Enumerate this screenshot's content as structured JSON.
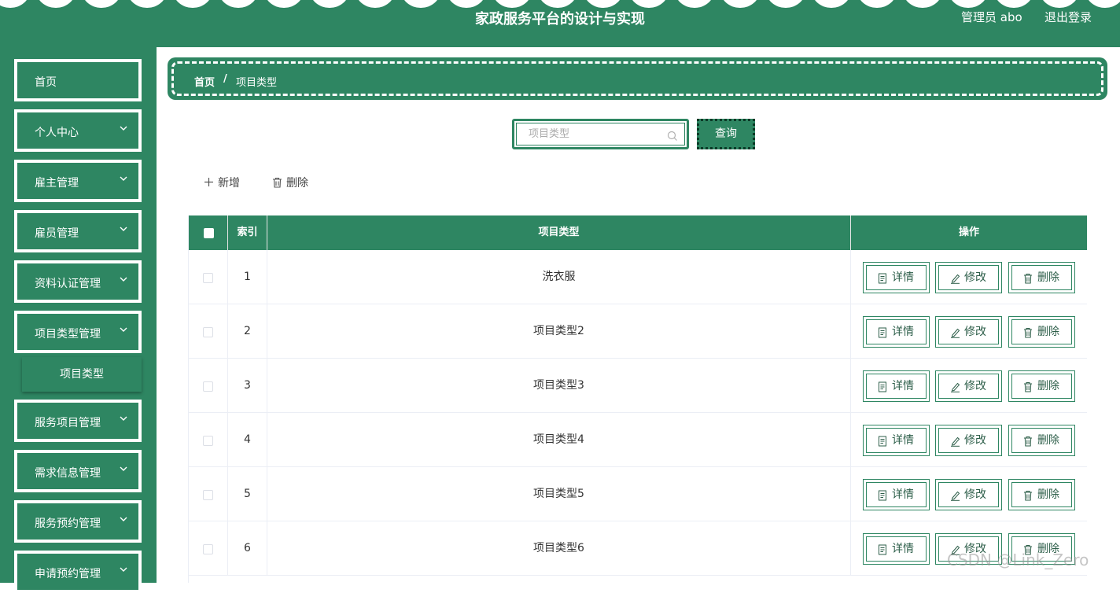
{
  "header": {
    "title": "家政服务平台的设计与实现",
    "user": "管理员 abo",
    "logout": "退出登录"
  },
  "sidebar": {
    "items": [
      {
        "label": "首页",
        "has_children": false
      },
      {
        "label": "个人中心",
        "has_children": true
      },
      {
        "label": "雇主管理",
        "has_children": true
      },
      {
        "label": "雇员管理",
        "has_children": true
      },
      {
        "label": "资料认证管理",
        "has_children": true
      },
      {
        "label": "项目类型管理",
        "has_children": true
      },
      {
        "label": "服务项目管理",
        "has_children": true
      },
      {
        "label": "需求信息管理",
        "has_children": true
      },
      {
        "label": "服务预约管理",
        "has_children": true
      },
      {
        "label": "申请预约管理",
        "has_children": true
      }
    ],
    "submenu": {
      "label": "项目类型"
    }
  },
  "breadcrumb": {
    "home": "首页",
    "separator": "/",
    "current": "项目类型"
  },
  "search": {
    "placeholder": "项目类型",
    "value": "",
    "button": "查询"
  },
  "toolbar": {
    "add": "新增",
    "delete": "删除"
  },
  "table": {
    "columns": {
      "index": "索引",
      "type": "项目类型",
      "actions": "操作"
    },
    "rows": [
      {
        "index": "1",
        "type": "洗衣服"
      },
      {
        "index": "2",
        "type": "项目类型2"
      },
      {
        "index": "3",
        "type": "项目类型3"
      },
      {
        "index": "4",
        "type": "项目类型4"
      },
      {
        "index": "5",
        "type": "项目类型5"
      },
      {
        "index": "6",
        "type": "项目类型6"
      }
    ],
    "actions": {
      "detail": "详情",
      "edit": "修改",
      "delete": "删除"
    }
  },
  "watermark": "CSDN @Link_Zero",
  "colors": {
    "primary": "#2e8662",
    "white": "#ffffff"
  }
}
